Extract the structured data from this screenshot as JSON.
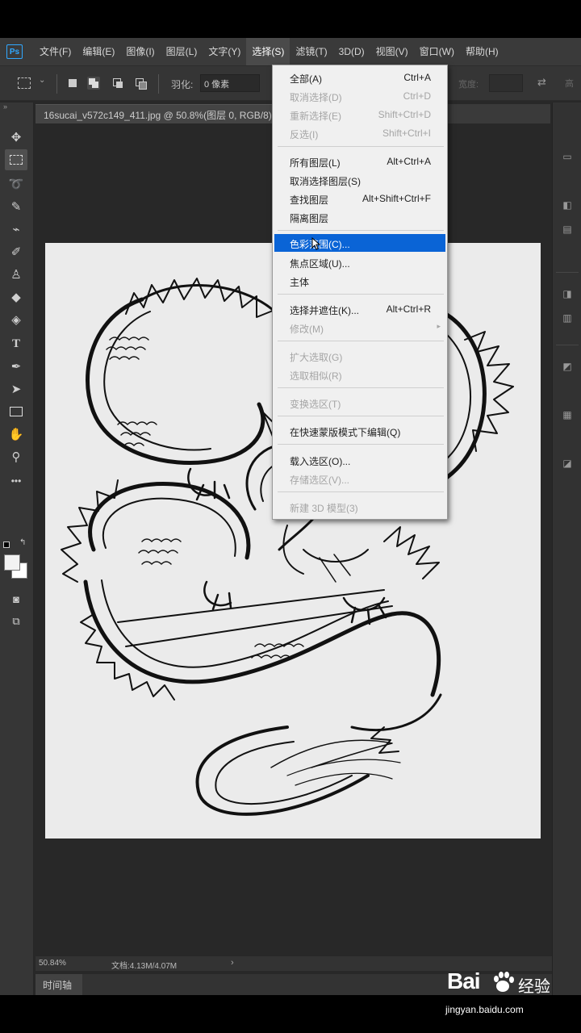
{
  "app": {
    "logo": "Ps",
    "menu": [
      "文件(F)",
      "编辑(E)",
      "图像(I)",
      "图层(L)",
      "文字(Y)",
      "选择(S)",
      "滤镜(T)",
      "3D(D)",
      "视图(V)",
      "窗口(W)",
      "帮助(H)"
    ],
    "active_menu_index": 5
  },
  "options": {
    "feather_label": "羽化:",
    "feather_value": "0 像素",
    "right_label": "宽度:"
  },
  "document": {
    "tab_title": "16sucai_v572c149_411.jpg @ 50.8%(图层 0, RGB/8)"
  },
  "status": {
    "zoom": "50.84%",
    "doc_size": "文档:4.13M/4.07M",
    "arrow": "›"
  },
  "timeline": {
    "tab": "时间轴"
  },
  "select_menu": {
    "items": [
      {
        "label": "全部(A)",
        "shortcut": "Ctrl+A",
        "state": "enabled"
      },
      {
        "label": "取消选择(D)",
        "shortcut": "Ctrl+D",
        "state": "disabled"
      },
      {
        "label": "重新选择(E)",
        "shortcut": "Shift+Ctrl+D",
        "state": "disabled"
      },
      {
        "label": "反选(I)",
        "shortcut": "Shift+Ctrl+I",
        "state": "disabled"
      },
      {
        "label": "所有图层(L)",
        "shortcut": "Alt+Ctrl+A",
        "state": "enabled"
      },
      {
        "label": "取消选择图层(S)",
        "shortcut": "",
        "state": "enabled"
      },
      {
        "label": "查找图层",
        "shortcut": "Alt+Shift+Ctrl+F",
        "state": "enabled"
      },
      {
        "label": "隔离图层",
        "shortcut": "",
        "state": "enabled"
      },
      {
        "label": "色彩范围(C)...",
        "shortcut": "",
        "state": "highlighted"
      },
      {
        "label": "焦点区域(U)...",
        "shortcut": "",
        "state": "enabled"
      },
      {
        "label": "主体",
        "shortcut": "",
        "state": "enabled"
      },
      {
        "label": "选择并遮住(K)...",
        "shortcut": "Alt+Ctrl+R",
        "state": "enabled"
      },
      {
        "label": "修改(M)",
        "shortcut": "",
        "state": "disabled",
        "submenu": "▸"
      },
      {
        "label": "扩大选取(G)",
        "shortcut": "",
        "state": "disabled"
      },
      {
        "label": "选取相似(R)",
        "shortcut": "",
        "state": "disabled"
      },
      {
        "label": "变换选区(T)",
        "shortcut": "",
        "state": "disabled"
      },
      {
        "label": "在快速蒙版模式下编辑(Q)",
        "shortcut": "",
        "state": "enabled"
      },
      {
        "label": "载入选区(O)...",
        "shortcut": "",
        "state": "enabled"
      },
      {
        "label": "存储选区(V)...",
        "shortcut": "",
        "state": "disabled"
      },
      {
        "label": "新建 3D 模型(3)",
        "shortcut": "",
        "state": "disabled"
      }
    ]
  },
  "tools": [
    "move-tool",
    "marquee-tool",
    "lasso-tool",
    "quick-select-tool",
    "eyedropper-tool",
    "brush-tool",
    "stamp-tool",
    "eraser-tool",
    "paint-bucket-tool",
    "type-tool",
    "pen-tool",
    "path-select-tool",
    "rectangle-tool",
    "hand-tool",
    "zoom-tool",
    "more-tools"
  ],
  "watermark": {
    "brand_left": "Bai",
    "brand_right": "经验",
    "url": "jingyan.baidu.com"
  },
  "colors": {
    "menu_highlight": "#0a64d6",
    "ps_blue": "#31a8ff",
    "canvas_bg": "#282828",
    "document_bg": "#ebebeb"
  }
}
